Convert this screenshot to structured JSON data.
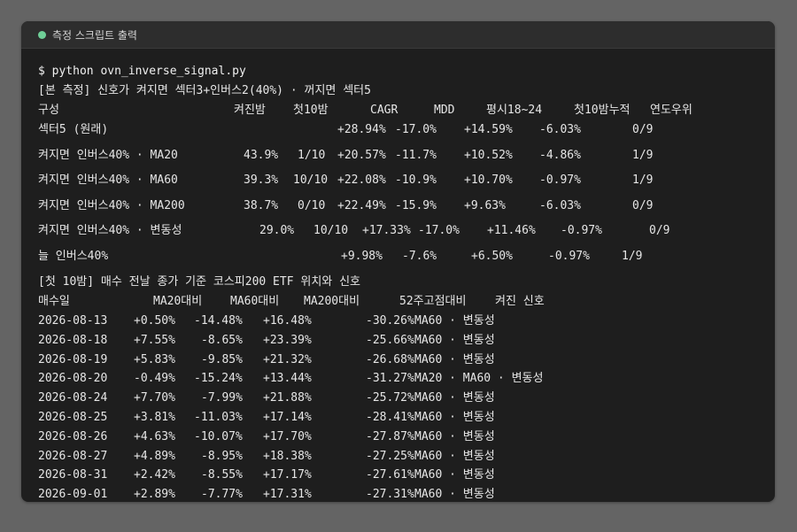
{
  "window": {
    "title": "측정 스크립트 출력",
    "status_dot_color": "#6fcf97"
  },
  "terminal": {
    "command": "$ python ovn_inverse_signal.py",
    "section1_title": "[본 측정] 신호가 켜지면 섹터3+인버스2(40%) · 꺼지면 섹터5",
    "table1": {
      "headers": [
        "구성",
        "켜진밤",
        "첫10밤",
        "CAGR",
        "MDD",
        "평시18~24",
        "첫10밤누적",
        "연도우위"
      ],
      "rows": [
        [
          "섹터5 (원래)",
          "",
          "",
          "+28.94%",
          "-17.0%",
          "+14.59%",
          "-6.03%",
          "0/9"
        ],
        [
          "켜지면 인버스40% · MA20",
          "43.9%",
          "1/10",
          "+20.57%",
          "-11.7%",
          "+10.52%",
          "-4.86%",
          "1/9"
        ],
        [
          "켜지면 인버스40% · MA60",
          "39.3%",
          "10/10",
          "+22.08%",
          "-10.9%",
          "+10.70%",
          "-0.97%",
          "1/9"
        ],
        [
          "켜지면 인버스40% · MA200",
          "38.7%",
          "0/10",
          "+22.49%",
          "-15.9%",
          "+9.63%",
          "-6.03%",
          "0/9"
        ],
        [
          "켜지면 인버스40% · 변동성",
          "29.0%",
          "10/10",
          "+17.33%",
          "-17.0%",
          "+11.46%",
          "-0.97%",
          "0/9"
        ],
        [
          "늘 인버스40%",
          "",
          "",
          "+9.98%",
          "-7.6%",
          "+6.50%",
          "-0.97%",
          "1/9"
        ]
      ]
    },
    "section2_title": "[첫 10밤] 매수 전날 종가 기준 코스피200 ETF 위치와 신호",
    "table2": {
      "headers": [
        "매수일",
        "MA20대비",
        "MA60대비",
        "MA200대비",
        "52주고점대비",
        "켜진 신호"
      ],
      "rows": [
        [
          "2026-08-13",
          "+0.50%",
          "-14.48%",
          "+16.48%",
          "-30.26%",
          "MA60 · 변동성"
        ],
        [
          "2026-08-18",
          "+7.55%",
          "-8.65%",
          "+23.39%",
          "-25.66%",
          "MA60 · 변동성"
        ],
        [
          "2026-08-19",
          "+5.83%",
          "-9.85%",
          "+21.32%",
          "-26.68%",
          "MA60 · 변동성"
        ],
        [
          "2026-08-20",
          "-0.49%",
          "-15.24%",
          "+13.44%",
          "-31.27%",
          "MA20 · MA60 · 변동성"
        ],
        [
          "2026-08-24",
          "+7.70%",
          "-7.99%",
          "+21.88%",
          "-25.72%",
          "MA60 · 변동성"
        ],
        [
          "2026-08-25",
          "+3.81%",
          "-11.03%",
          "+17.14%",
          "-28.41%",
          "MA60 · 변동성"
        ],
        [
          "2026-08-26",
          "+4.63%",
          "-10.07%",
          "+17.70%",
          "-27.87%",
          "MA60 · 변동성"
        ],
        [
          "2026-08-27",
          "+4.89%",
          "-8.95%",
          "+18.38%",
          "-27.25%",
          "MA60 · 변동성"
        ],
        [
          "2026-08-31",
          "+2.42%",
          "-8.55%",
          "+17.17%",
          "-27.61%",
          "MA60 · 변동성"
        ],
        [
          "2026-09-01",
          "+2.89%",
          "-7.77%",
          "+17.31%",
          "-27.31%",
          "MA60 · 변동성"
        ]
      ]
    }
  }
}
